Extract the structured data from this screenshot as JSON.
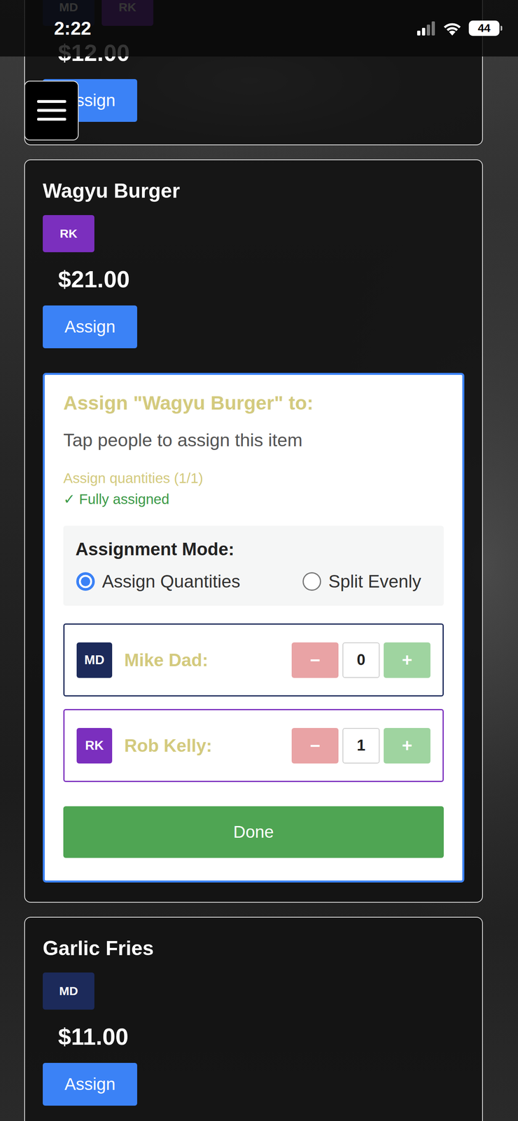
{
  "status_bar": {
    "time": "2:22",
    "battery": "44"
  },
  "items": [
    {
      "assignees": [
        {
          "initials": "MD",
          "color": "#1c2a5a"
        },
        {
          "initials": "RK",
          "color": "#7b2fbe"
        }
      ],
      "price": "$12.00",
      "button": "Assign",
      "expanded": false
    },
    {
      "name": "Wagyu Burger",
      "assignees": [
        {
          "initials": "RK",
          "color": "#7b2fbe"
        }
      ],
      "price": "$21.00",
      "button": "Assign",
      "expanded": true
    },
    {
      "name": "Garlic Fries",
      "assignees": [
        {
          "initials": "MD",
          "color": "#1c2a5a"
        }
      ],
      "price": "$11.00",
      "button": "Assign",
      "expanded": false
    }
  ],
  "assign_panel": {
    "title": "Assign \"Wagyu Burger\" to:",
    "hint": "Tap people to assign this item",
    "progress": "Assign quantities (1/1)",
    "status": "✓ Fully assigned",
    "mode_label": "Assignment Mode:",
    "modes": [
      {
        "label": "Assign Quantities",
        "selected": true
      },
      {
        "label": "Split Evenly",
        "selected": false
      }
    ],
    "people": [
      {
        "initials": "MD",
        "name": "Mike Dad:",
        "quantity": "0",
        "color": "#1c2a5a"
      },
      {
        "initials": "RK",
        "name": "Rob Kelly:",
        "quantity": "1",
        "color": "#7b2fbe"
      }
    ],
    "minus": "−",
    "plus": "+",
    "done": "Done"
  }
}
